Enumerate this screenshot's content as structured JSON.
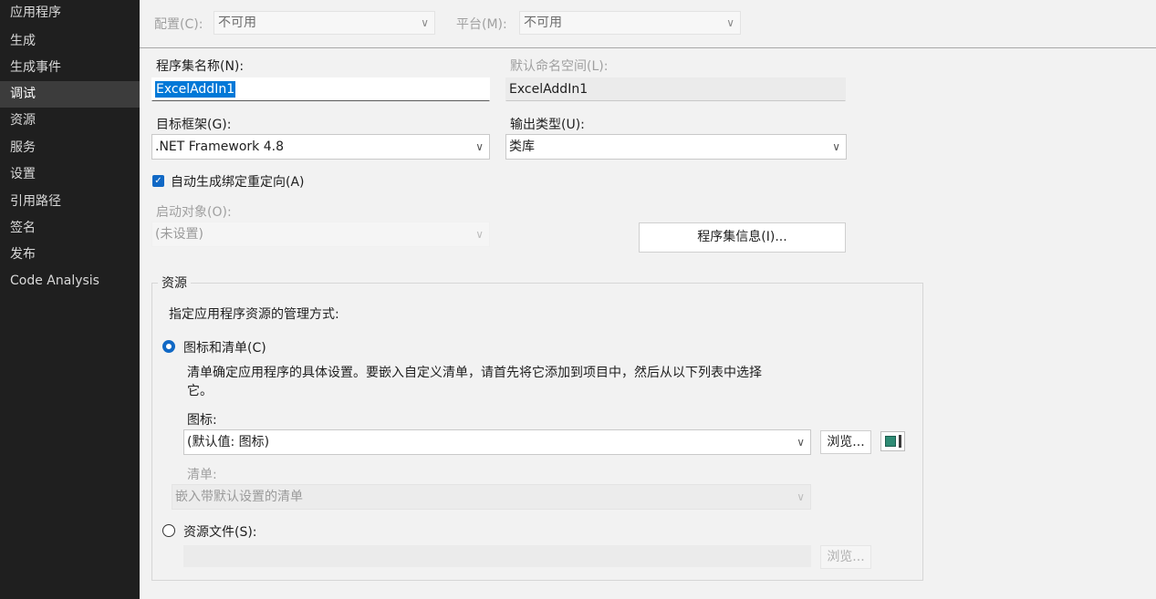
{
  "sidebar": {
    "items": [
      {
        "label": "应用程序",
        "active": false
      },
      {
        "label": "生成",
        "active": false
      },
      {
        "label": "生成事件",
        "active": false
      },
      {
        "label": "调试",
        "active": true
      },
      {
        "label": "资源",
        "active": false
      },
      {
        "label": "服务",
        "active": false
      },
      {
        "label": "设置",
        "active": false
      },
      {
        "label": "引用路径",
        "active": false
      },
      {
        "label": "签名",
        "active": false
      },
      {
        "label": "发布",
        "active": false
      },
      {
        "label": "Code Analysis",
        "active": false
      }
    ]
  },
  "config": {
    "configuration_label": "配置(C):",
    "configuration_value": "不可用",
    "platform_label": "平台(M):",
    "platform_value": "不可用"
  },
  "assembly": {
    "name_label": "程序集名称(N):",
    "name_value": "ExcelAddIn1",
    "namespace_label": "默认命名空间(L):",
    "namespace_value": "ExcelAddIn1"
  },
  "framework": {
    "label": "目标框架(G):",
    "value": ".NET Framework 4.8"
  },
  "output": {
    "label": "输出类型(U):",
    "value": "类库"
  },
  "auto_redirect": {
    "label": "自动生成绑定重定向(A)",
    "checked": true
  },
  "startup": {
    "label": "启动对象(O):",
    "value": "(未设置)"
  },
  "assembly_info_button": "程序集信息(I)...",
  "resources": {
    "group_title": "资源",
    "description": "指定应用程序资源的管理方式:",
    "option_icon_manifest": {
      "label": "图标和清单(C)",
      "selected": true,
      "help_line1": "清单确定应用程序的具体设置。要嵌入自定义清单，请首先将它添加到项目中，然后从以下列表中选择",
      "help_line2": "它。"
    },
    "icon_label": "图标:",
    "icon_value": "(默认值: 图标)",
    "browse_label": "浏览...",
    "manifest_label": "清单:",
    "manifest_value": "嵌入带默认设置的清单",
    "option_resource_file": {
      "label": "资源文件(S):",
      "selected": false
    },
    "resource_file_value": "",
    "resource_browse_label": "浏览..."
  }
}
